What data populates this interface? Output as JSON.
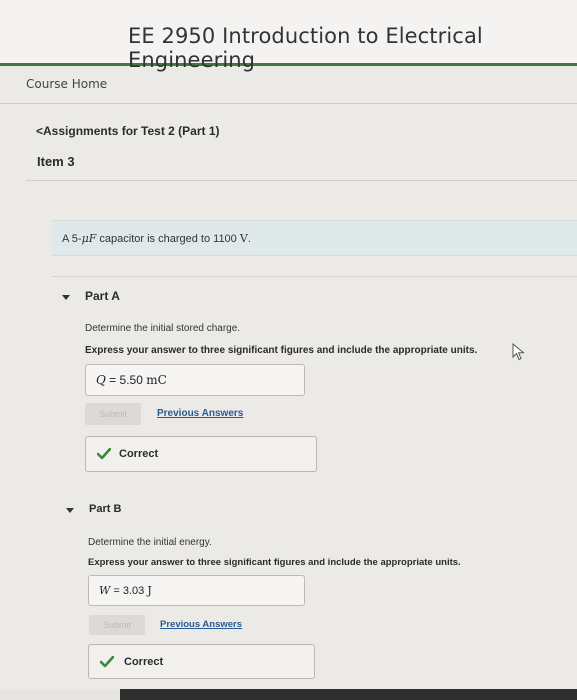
{
  "header": {
    "course_title": "EE 2950 Introduction to Electrical Engineering"
  },
  "nav": {
    "course_home": "Course Home"
  },
  "breadcrumb": {
    "back_label": "Assignments for Test 2 (Part 1)"
  },
  "item": {
    "label": "Item 3"
  },
  "question": {
    "prefix": "A 5-",
    "unit_symbol": "μF",
    "middle": " capacitor is charged to 1100 ",
    "volt_symbol": "V",
    "suffix": "."
  },
  "parts": [
    {
      "title": "Part A",
      "prompt": "Determine the initial stored charge.",
      "instruction": "Express your answer to three significant figures and include the appropriate units.",
      "answer_var": "Q",
      "answer_eq": " = ",
      "answer_value": "5.50 ",
      "answer_unit": "mC",
      "submit_label": "Submit",
      "previous_answers_label": "Previous Answers",
      "status": "Correct"
    },
    {
      "title": "Part B",
      "prompt": "Determine the initial energy.",
      "instruction": "Express your answer to three significant figures and include the appropriate units.",
      "answer_var": "W",
      "answer_eq": " = ",
      "answer_value": "3.03 ",
      "answer_unit": "J",
      "submit_label": "Submit",
      "previous_answers_label": "Previous Answers",
      "status": "Correct"
    }
  ],
  "colors": {
    "accent_green": "#3f7a45",
    "question_bg": "#dfe9ea",
    "link_blue": "#2a5a96",
    "check_green": "#3a8a3a"
  },
  "icons": {
    "caret": "caret-down-icon",
    "check": "check-icon",
    "cursor": "mouse-cursor-icon"
  }
}
